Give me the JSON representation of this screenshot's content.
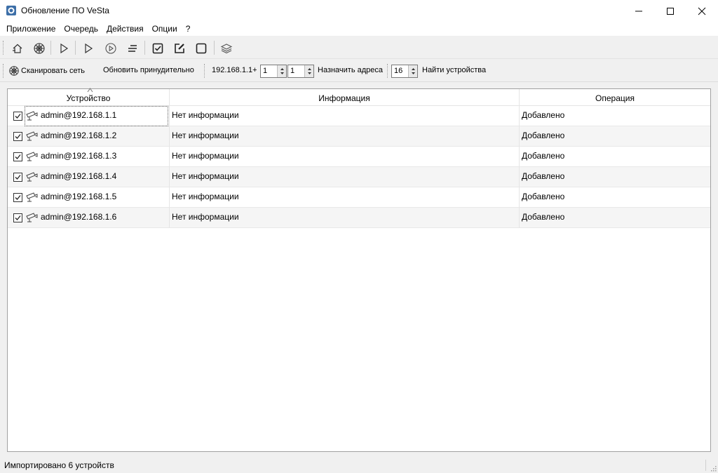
{
  "window": {
    "title": "Обновление ПО VeSta"
  },
  "menu": [
    "Приложение",
    "Очередь",
    "Действия",
    "Опции",
    "?"
  ],
  "toolbar_icons": [
    "home-icon",
    "scan-icon",
    "play-icon",
    "play-icon",
    "play-circle-icon",
    "list-icon",
    "check-all-icon",
    "edit-icon",
    "uncheck-icon",
    "layers-icon"
  ],
  "toolbar2": {
    "scan_label": "Сканировать сеть",
    "force_update_label": "Обновить принудительно",
    "ip_prefix": "192.168.1.1+",
    "spin1_value": "1",
    "spin2_value": "1",
    "assign_label": "Назначить адреса",
    "spin3_value": "16",
    "find_label": "Найти устройства"
  },
  "table": {
    "columns": [
      "Устройство",
      "Информация",
      "Операция"
    ],
    "rows": [
      {
        "device": "admin@192.168.1.1",
        "info": "Нет информации",
        "operation": "Добавлено",
        "checked": true
      },
      {
        "device": "admin@192.168.1.2",
        "info": "Нет информации",
        "operation": "Добавлено",
        "checked": true
      },
      {
        "device": "admin@192.168.1.3",
        "info": "Нет информации",
        "operation": "Добавлено",
        "checked": true
      },
      {
        "device": "admin@192.168.1.4",
        "info": "Нет информации",
        "operation": "Добавлено",
        "checked": true
      },
      {
        "device": "admin@192.168.1.5",
        "info": "Нет информации",
        "operation": "Добавлено",
        "checked": true
      },
      {
        "device": "admin@192.168.1.6",
        "info": "Нет информации",
        "operation": "Добавлено",
        "checked": true
      }
    ]
  },
  "status": {
    "text": "Импортировано 6 устройств"
  }
}
